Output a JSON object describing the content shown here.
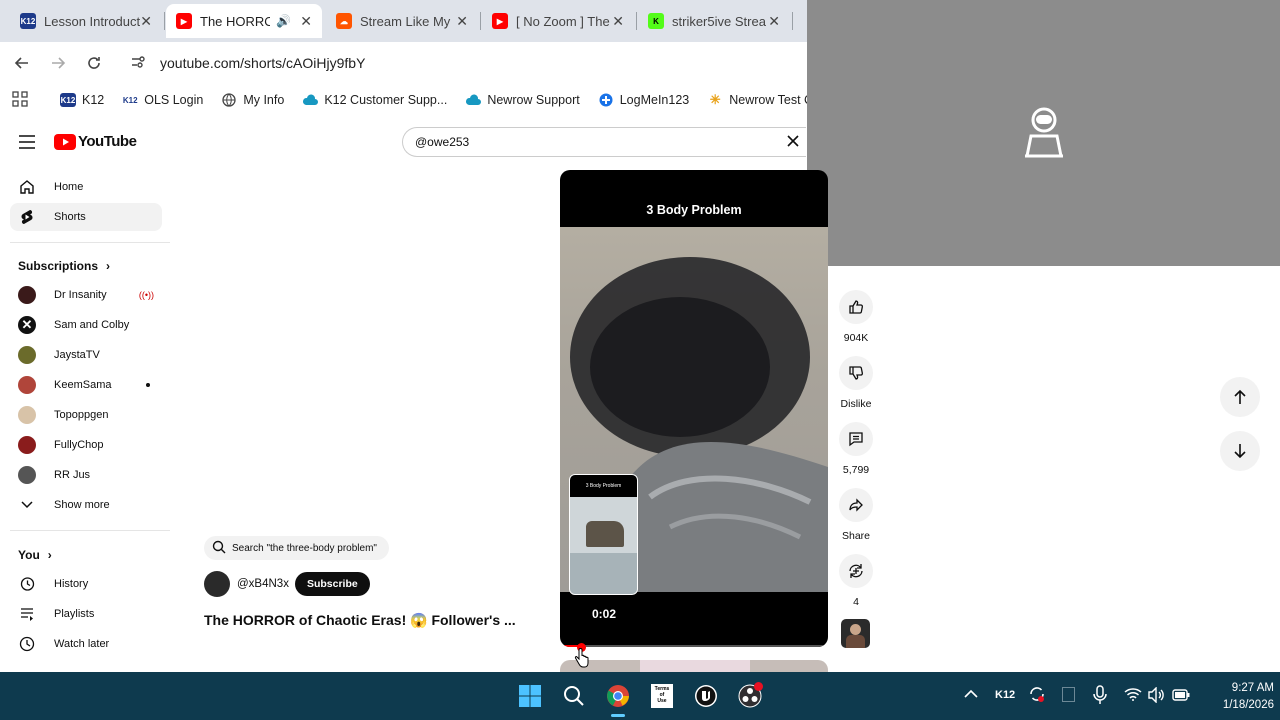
{
  "browser": {
    "tabs": [
      {
        "title": "Lesson Introduct",
        "favicon": "k12",
        "active": false
      },
      {
        "title": "The HORRO",
        "favicon": "youtube",
        "active": true
      },
      {
        "title": "Stream Like My",
        "favicon": "soundcloud",
        "active": false
      },
      {
        "title": "[ No Zoom ] The",
        "favicon": "youtube",
        "active": false
      },
      {
        "title": "striker5ive Strea",
        "favicon": "kick",
        "active": false
      }
    ],
    "url": "youtube.com/shorts/cAOiHjy9fbY",
    "bookmarks": [
      {
        "label": "K12",
        "icon": "k12"
      },
      {
        "label": "OLS Login",
        "icon": "k12"
      },
      {
        "label": "My Info",
        "icon": "globe-icon"
      },
      {
        "label": "K12 Customer Supp...",
        "icon": "cloud-icon"
      },
      {
        "label": "Newrow Support",
        "icon": "cloud-icon"
      },
      {
        "label": "LogMeIn123",
        "icon": "logmein-icon"
      },
      {
        "label": "Newrow Test Check",
        "icon": "sparkle-icon"
      }
    ]
  },
  "youtube": {
    "logo_text": "YouTube",
    "search_value": "@owe253",
    "sidebar": {
      "main": [
        {
          "label": "Home",
          "icon": "home-icon"
        },
        {
          "label": "Shorts",
          "icon": "shorts-icon",
          "active": true
        }
      ],
      "subscriptions_heading": "Subscriptions",
      "subscriptions": [
        {
          "label": "Dr Insanity",
          "live": true,
          "color": "#3a1a1a"
        },
        {
          "label": "Sam and Colby",
          "color": "#111111"
        },
        {
          "label": "JaystaTV",
          "color": "#6b6b2b"
        },
        {
          "label": "KeemSama",
          "dot": true,
          "color": "#b0453a"
        },
        {
          "label": "Topoppgen",
          "color": "#d8c3a8"
        },
        {
          "label": "FullyChop",
          "color": "#8a1c1c"
        },
        {
          "label": "RR Jus",
          "color": "#555555"
        }
      ],
      "show_more": "Show more",
      "you_heading": "You",
      "you_items": [
        {
          "label": "History",
          "icon": "history-icon"
        },
        {
          "label": "Playlists",
          "icon": "playlist-icon"
        },
        {
          "label": "Watch later",
          "icon": "clock-icon"
        }
      ]
    },
    "short": {
      "search_suggestion": "Search \"the three-body problem\"",
      "channel": "@xB4N3x",
      "subscribe_label": "Subscribe",
      "title": "The HORROR of Chaotic Eras! 😱 Follower's ...",
      "video_caption": "3 Body Problem",
      "preview_caption": "3 Body Problem",
      "time": "0:02",
      "progress": 0.08
    },
    "actions": {
      "like_count": "904K",
      "dislike_label": "Dislike",
      "comment_count": "5,799",
      "share_label": "Share",
      "remix_count": "4"
    }
  },
  "taskbar": {
    "tray_label": "K12",
    "time": "9:27 AM",
    "date": "1/18/2026"
  }
}
